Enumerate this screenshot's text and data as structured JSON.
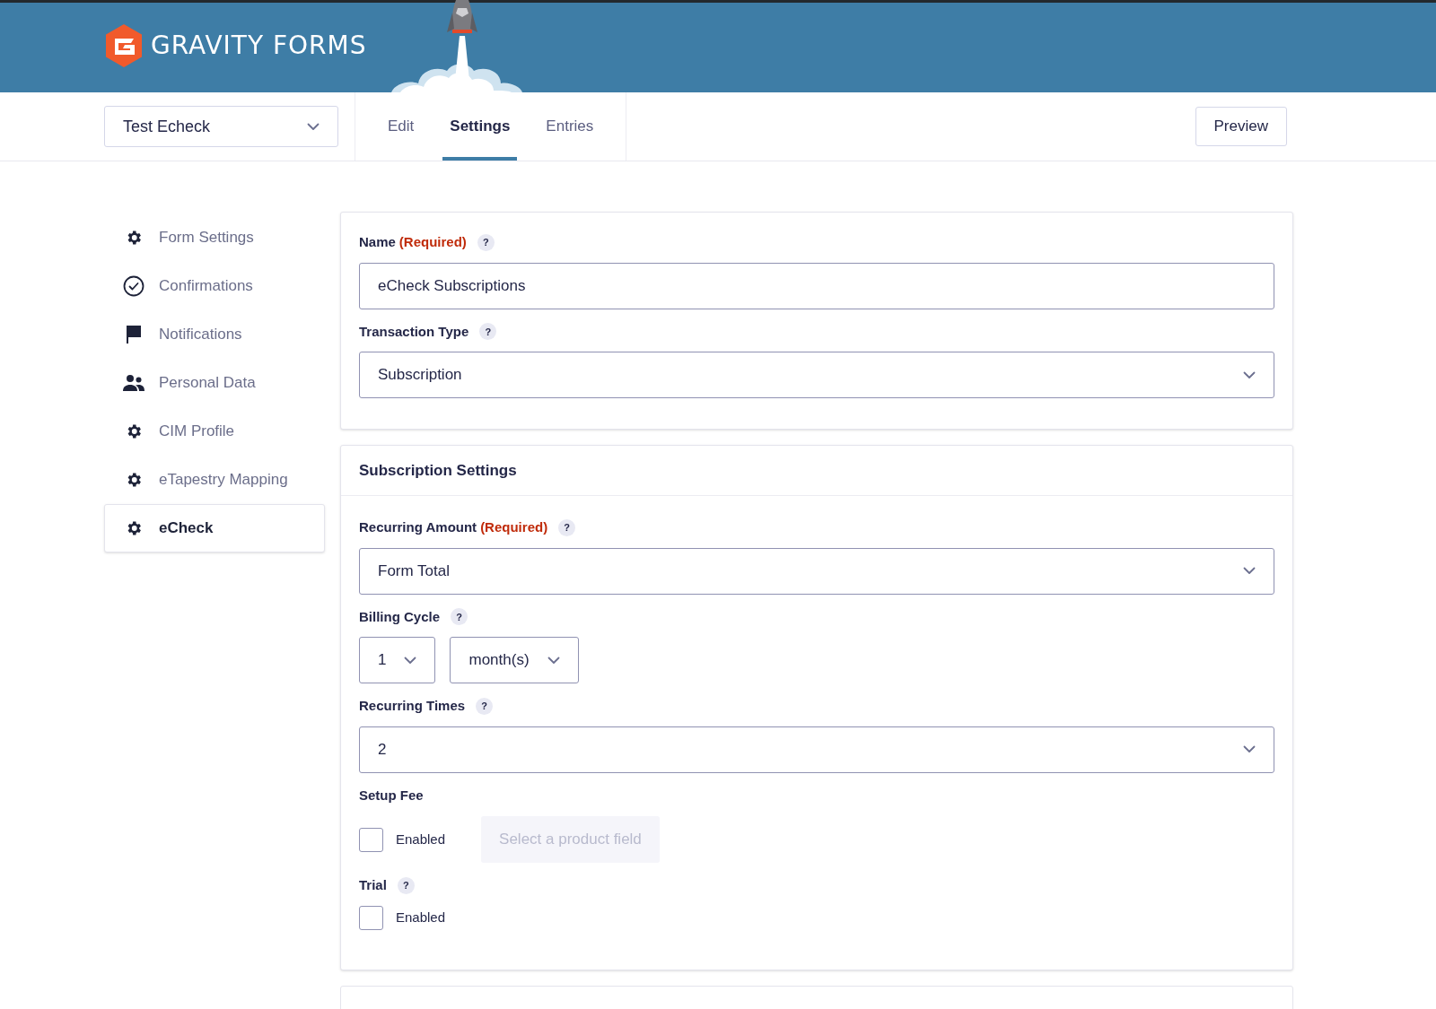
{
  "header": {
    "brand": "GRAVITY FORMS"
  },
  "form_select": {
    "value": "Test Echeck"
  },
  "tabs": [
    {
      "label": "Edit",
      "selected": false
    },
    {
      "label": "Settings",
      "selected": true
    },
    {
      "label": "Entries",
      "selected": false
    }
  ],
  "preview_button": "Preview",
  "sidebar": {
    "items": [
      {
        "label": "Form Settings",
        "selected": false
      },
      {
        "label": "Confirmations",
        "selected": false
      },
      {
        "label": "Notifications",
        "selected": false
      },
      {
        "label": "Personal Data",
        "selected": false
      },
      {
        "label": "CIM Profile",
        "selected": false
      },
      {
        "label": "eTapestry Mapping",
        "selected": false
      },
      {
        "label": "eCheck",
        "selected": true
      }
    ]
  },
  "panels": [
    {
      "fields": [
        {
          "kind": "text",
          "label": "Name",
          "required": "(Required)",
          "help": "?",
          "value": "eCheck Subscriptions"
        },
        {
          "kind": "select",
          "label": "Transaction Type",
          "help": "?",
          "value": "Subscription"
        }
      ]
    },
    {
      "title": "Subscription Settings",
      "fields": [
        {
          "kind": "select",
          "label": "Recurring Amount",
          "required": "(Required)",
          "help": "?",
          "value": "Form Total"
        },
        {
          "kind": "select_pair",
          "label": "Billing Cycle",
          "help": "?",
          "values": [
            "1",
            "month(s)"
          ]
        },
        {
          "kind": "select",
          "label": "Recurring Times",
          "help": "?",
          "value": "2"
        },
        {
          "kind": "checkbox_product",
          "label": "Setup Fee",
          "checkbox_label": "Enabled",
          "checked": false,
          "placeholder": "Select a product field"
        },
        {
          "kind": "checkbox",
          "label": "Trial",
          "help": "?",
          "checkbox_label": "Enabled",
          "checked": false
        }
      ]
    }
  ]
}
